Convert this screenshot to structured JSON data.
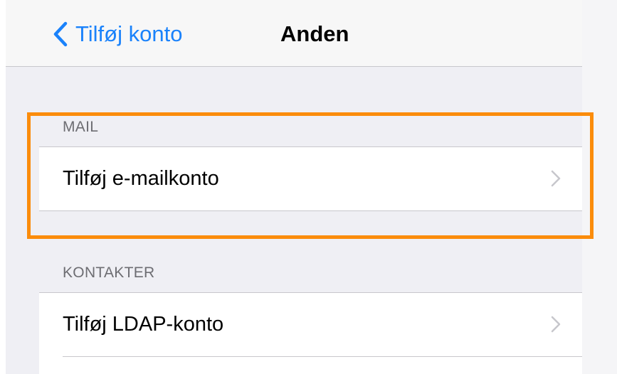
{
  "nav": {
    "back_label": "Tilføj konto",
    "title": "Anden"
  },
  "sections": {
    "mail": {
      "header": "MAIL",
      "item_label": "Tilføj e-mailkonto"
    },
    "contacts": {
      "header": "KONTAKTER",
      "item_label": "Tilføj LDAP-konto"
    }
  },
  "colors": {
    "accent": "#1a82fb",
    "highlight": "#fb8c0b",
    "background": "#efeff4",
    "section_header": "#6d6d72"
  },
  "icons": {
    "back": "chevron-left-icon",
    "disclosure": "chevron-right-icon"
  }
}
